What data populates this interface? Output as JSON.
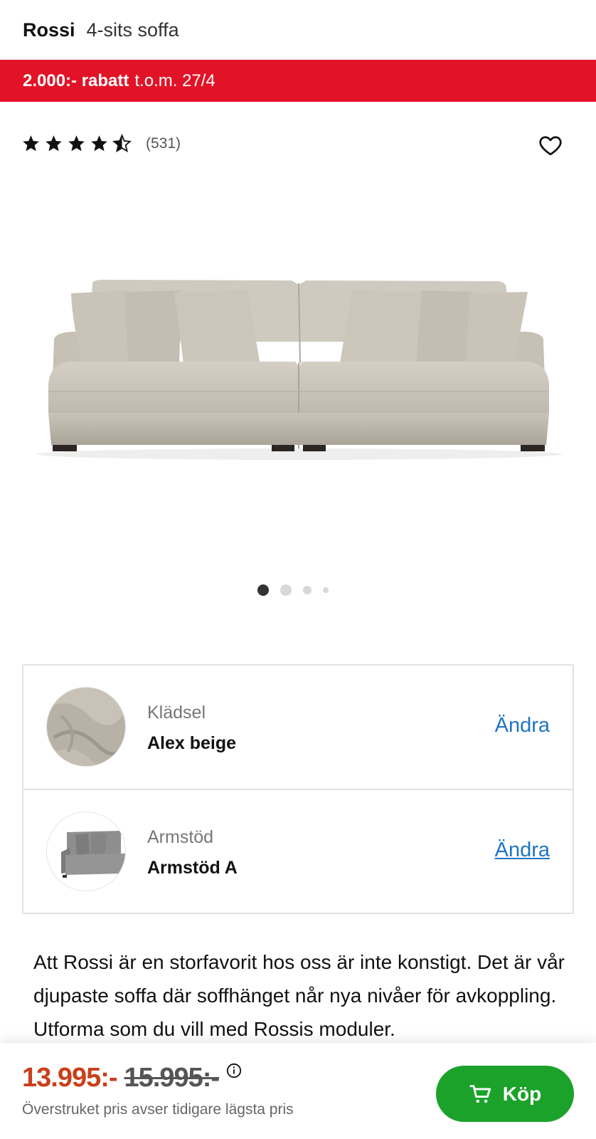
{
  "header": {
    "brand": "Rossi",
    "subtitle": "4-sits soffa"
  },
  "promo": {
    "highlight": "2.000:- rabatt",
    "rest": "t.o.m. 27/4",
    "color": "#e31327"
  },
  "rating": {
    "stars": 4.5,
    "max": 5,
    "count": "(531)"
  },
  "favorite": {
    "icon": "heart-icon"
  },
  "gallery": {
    "image": "beige-four-seat-sofa",
    "total_images": 4,
    "active_index": 0
  },
  "options": [
    {
      "label": "Klädsel",
      "value": "Alex beige",
      "action": "Ändra",
      "thumbnail": "fabric-swatch"
    },
    {
      "label": "Armstöd",
      "value": "Armstöd A",
      "action": "Ändra",
      "thumbnail": "armrest-preview"
    }
  ],
  "description": "Att Rossi är en storfavorit hos oss är inte konstigt. Det är vår djupaste soffa där soffhänget når nya nivåer för avkoppling. Utforma som du vill med Rossis moduler.",
  "footer": {
    "price": "13.995:-",
    "old_price": "15.995:-",
    "price_note": "Överstruket pris avser tidigare lägsta pris",
    "buy_label": "Köp",
    "price_color": "#c8401b",
    "buy_color": "#1ba22a"
  }
}
